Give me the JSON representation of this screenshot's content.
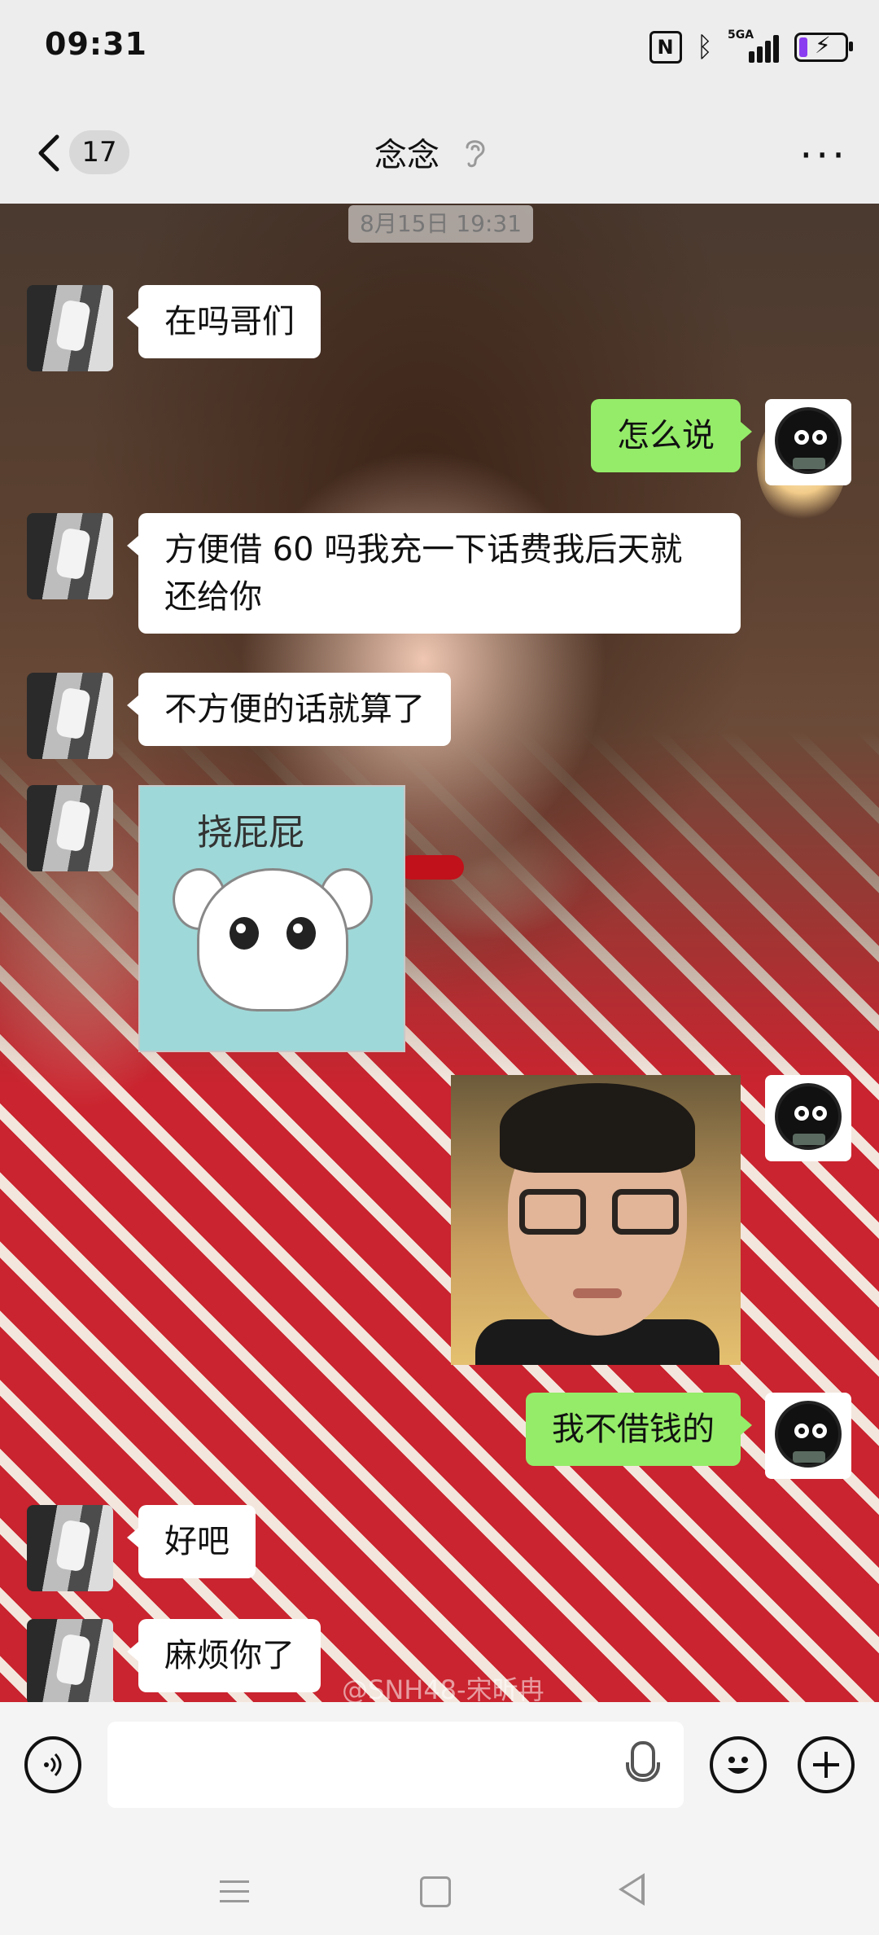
{
  "status_bar": {
    "time": "09:31",
    "network_label": "5GA",
    "icons": [
      "nfc-icon",
      "bluetooth-icon",
      "signal-icon",
      "battery-charging-icon"
    ]
  },
  "header": {
    "unread_count": "17",
    "contact_name": "念念",
    "icons": [
      "back-icon",
      "earpiece-icon",
      "more-icon"
    ]
  },
  "chat": {
    "timestamp": "8月15日 19:31",
    "messages": [
      {
        "from": "them",
        "type": "text",
        "text": "在吗哥们"
      },
      {
        "from": "me",
        "type": "text",
        "text": "怎么说"
      },
      {
        "from": "them",
        "type": "text",
        "text": "方便借 60 吗我充一下话费我后天就还给你"
      },
      {
        "from": "them",
        "type": "text",
        "text": "不方便的话就算了"
      },
      {
        "from": "them",
        "type": "sticker",
        "caption": "挠屁屁"
      },
      {
        "from": "me",
        "type": "sticker",
        "caption": ""
      },
      {
        "from": "me",
        "type": "text",
        "text": "我不借钱的"
      },
      {
        "from": "them",
        "type": "text",
        "text": "好吧"
      },
      {
        "from": "them",
        "type": "text",
        "text": "麻烦你了"
      }
    ],
    "background_watermark": "@SNH48-宋昕冉"
  },
  "input_bar": {
    "icons": [
      "voice-toggle-icon",
      "microphone-icon",
      "emoji-icon",
      "plus-icon"
    ],
    "text_value": ""
  },
  "colors": {
    "outgoing_bubble": "#95ec69",
    "incoming_bubble": "#ffffff",
    "bar_background": "#ededed"
  }
}
